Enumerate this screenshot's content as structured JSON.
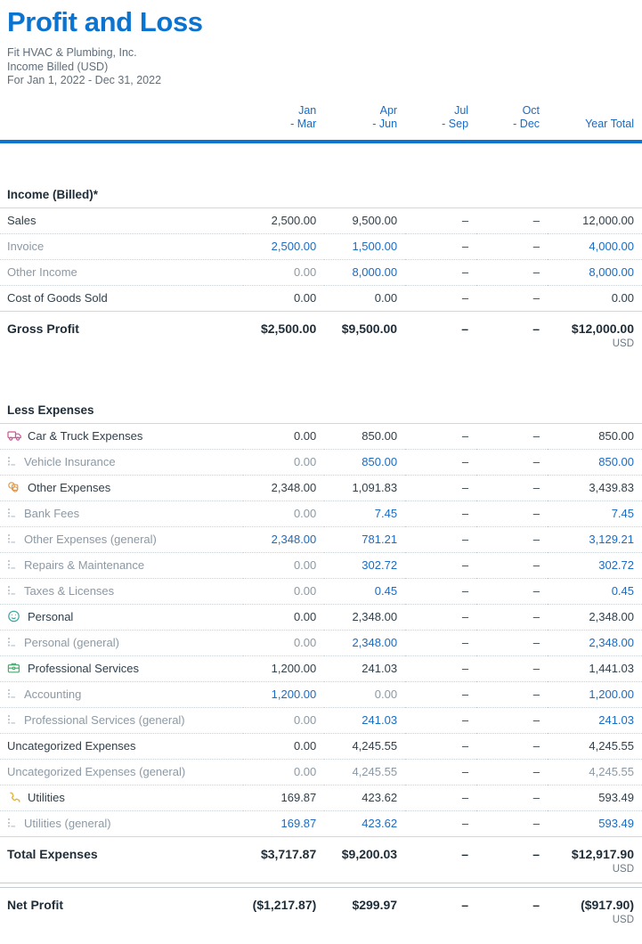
{
  "report": {
    "title": "Profit and Loss",
    "company": "Fit HVAC & Plumbing, Inc.",
    "basis": "Income Billed (USD)",
    "period": "For Jan 1, 2022 - Dec 31, 2022",
    "accent_blue": "#0b74d1",
    "link_blue": "#1a6bc4",
    "text_dark": "#31404b",
    "text_gray": "#8c99a4"
  },
  "columns": [
    {
      "line1": "Jan",
      "line2": "- Mar"
    },
    {
      "line1": "Apr",
      "line2": "- Jun"
    },
    {
      "line1": "Jul",
      "line2": "- Sep"
    },
    {
      "line1": "Oct",
      "line2": "- Dec"
    },
    {
      "line1": "Year Total",
      "line2": ""
    }
  ],
  "sections": {
    "income": {
      "heading": "Income (Billed)*",
      "rows": [
        {
          "label": "Sales",
          "level": 1,
          "style": "dark",
          "values": [
            "2,500.00",
            "9,500.00",
            "–",
            "–",
            "12,000.00"
          ],
          "value_styles": [
            "dark",
            "dark",
            "dark",
            "dark",
            "dark"
          ]
        },
        {
          "label": "Invoice",
          "level": 2,
          "style": "gray",
          "values": [
            "2,500.00",
            "1,500.00",
            "–",
            "–",
            "4,000.00"
          ],
          "value_styles": [
            "link",
            "link",
            "dark",
            "dark",
            "link"
          ]
        },
        {
          "label": "Other Income",
          "level": 2,
          "style": "gray",
          "values": [
            "0.00",
            "8,000.00",
            "–",
            "–",
            "8,000.00"
          ],
          "value_styles": [
            "gray",
            "link",
            "dark",
            "dark",
            "link"
          ]
        },
        {
          "label": "Cost of Goods Sold",
          "level": 1,
          "style": "dark",
          "values": [
            "0.00",
            "0.00",
            "–",
            "–",
            "0.00"
          ],
          "value_styles": [
            "dark",
            "dark",
            "dark",
            "dark",
            "dark"
          ]
        }
      ],
      "total": {
        "label": "Gross Profit",
        "values": [
          "$2,500.00",
          "$9,500.00",
          "–",
          "–",
          "$12,000.00"
        ],
        "currency": "USD"
      }
    },
    "expenses": {
      "heading": "Less Expenses",
      "rows": [
        {
          "label": "Car & Truck Expenses",
          "level": 1,
          "style": "dark",
          "icon": "truck-icon",
          "values": [
            "0.00",
            "850.00",
            "–",
            "–",
            "850.00"
          ],
          "value_styles": [
            "dark",
            "dark",
            "dark",
            "dark",
            "dark"
          ]
        },
        {
          "label": "Vehicle Insurance",
          "level": 2,
          "style": "gray",
          "icon": "indent-icon",
          "values": [
            "0.00",
            "850.00",
            "–",
            "–",
            "850.00"
          ],
          "value_styles": [
            "gray",
            "link",
            "dark",
            "dark",
            "link"
          ]
        },
        {
          "label": "Other Expenses",
          "level": 1,
          "style": "dark",
          "icon": "shapes-icon",
          "values": [
            "2,348.00",
            "1,091.83",
            "–",
            "–",
            "3,439.83"
          ],
          "value_styles": [
            "dark",
            "dark",
            "dark",
            "dark",
            "dark"
          ]
        },
        {
          "label": "Bank Fees",
          "level": 2,
          "style": "gray",
          "icon": "indent-icon",
          "values": [
            "0.00",
            "7.45",
            "–",
            "–",
            "7.45"
          ],
          "value_styles": [
            "gray",
            "link",
            "dark",
            "dark",
            "link"
          ]
        },
        {
          "label": "Other Expenses (general)",
          "level": 2,
          "style": "gray",
          "icon": "indent-icon",
          "values": [
            "2,348.00",
            "781.21",
            "–",
            "–",
            "3,129.21"
          ],
          "value_styles": [
            "link",
            "link",
            "dark",
            "dark",
            "link"
          ]
        },
        {
          "label": "Repairs & Maintenance",
          "level": 2,
          "style": "gray",
          "icon": "indent-icon",
          "values": [
            "0.00",
            "302.72",
            "–",
            "–",
            "302.72"
          ],
          "value_styles": [
            "gray",
            "link",
            "dark",
            "dark",
            "link"
          ]
        },
        {
          "label": "Taxes & Licenses",
          "level": 2,
          "style": "gray",
          "icon": "indent-icon",
          "values": [
            "0.00",
            "0.45",
            "–",
            "–",
            "0.45"
          ],
          "value_styles": [
            "gray",
            "link",
            "dark",
            "dark",
            "link"
          ]
        },
        {
          "label": "Personal",
          "level": 1,
          "style": "dark",
          "icon": "smiley-icon",
          "values": [
            "0.00",
            "2,348.00",
            "–",
            "–",
            "2,348.00"
          ],
          "value_styles": [
            "dark",
            "dark",
            "dark",
            "dark",
            "dark"
          ]
        },
        {
          "label": "Personal (general)",
          "level": 2,
          "style": "gray",
          "icon": "indent-icon",
          "values": [
            "0.00",
            "2,348.00",
            "–",
            "–",
            "2,348.00"
          ],
          "value_styles": [
            "gray",
            "link",
            "dark",
            "dark",
            "link"
          ]
        },
        {
          "label": "Professional Services",
          "level": 1,
          "style": "dark",
          "icon": "briefcase-icon",
          "values": [
            "1,200.00",
            "241.03",
            "–",
            "–",
            "1,441.03"
          ],
          "value_styles": [
            "dark",
            "dark",
            "dark",
            "dark",
            "dark"
          ]
        },
        {
          "label": "Accounting",
          "level": 2,
          "style": "gray",
          "icon": "indent-icon",
          "values": [
            "1,200.00",
            "0.00",
            "–",
            "–",
            "1,200.00"
          ],
          "value_styles": [
            "link",
            "gray",
            "dark",
            "dark",
            "link"
          ]
        },
        {
          "label": "Professional Services (general)",
          "level": 2,
          "style": "gray",
          "icon": "indent-icon",
          "values": [
            "0.00",
            "241.03",
            "–",
            "–",
            "241.03"
          ],
          "value_styles": [
            "gray",
            "link",
            "dark",
            "dark",
            "link"
          ]
        },
        {
          "label": "Uncategorized Expenses",
          "level": 1,
          "style": "dark",
          "icon": "none",
          "values": [
            "0.00",
            "4,245.55",
            "–",
            "–",
            "4,245.55"
          ],
          "value_styles": [
            "dark",
            "dark",
            "dark",
            "dark",
            "dark"
          ]
        },
        {
          "label": "Uncategorized Expenses (general)",
          "level": 2,
          "style": "gray",
          "icon": "none",
          "values": [
            "0.00",
            "4,245.55",
            "–",
            "–",
            "4,245.55"
          ],
          "value_styles": [
            "gray",
            "gray",
            "dark",
            "dark",
            "gray"
          ]
        },
        {
          "label": "Utilities",
          "level": 1,
          "style": "dark",
          "icon": "phone-icon",
          "values": [
            "169.87",
            "423.62",
            "–",
            "–",
            "593.49"
          ],
          "value_styles": [
            "dark",
            "dark",
            "dark",
            "dark",
            "dark"
          ]
        },
        {
          "label": "Utilities (general)",
          "level": 2,
          "style": "gray",
          "icon": "indent-icon",
          "values": [
            "169.87",
            "423.62",
            "–",
            "–",
            "593.49"
          ],
          "value_styles": [
            "link",
            "link",
            "dark",
            "dark",
            "link"
          ]
        }
      ],
      "total": {
        "label": "Total Expenses",
        "values": [
          "$3,717.87",
          "$9,200.03",
          "–",
          "–",
          "$12,917.90"
        ],
        "currency": "USD"
      }
    },
    "net": {
      "total": {
        "label": "Net Profit",
        "values": [
          "($1,217.87)",
          "$299.97",
          "–",
          "–",
          "($917.90)"
        ],
        "currency": "USD"
      }
    }
  }
}
